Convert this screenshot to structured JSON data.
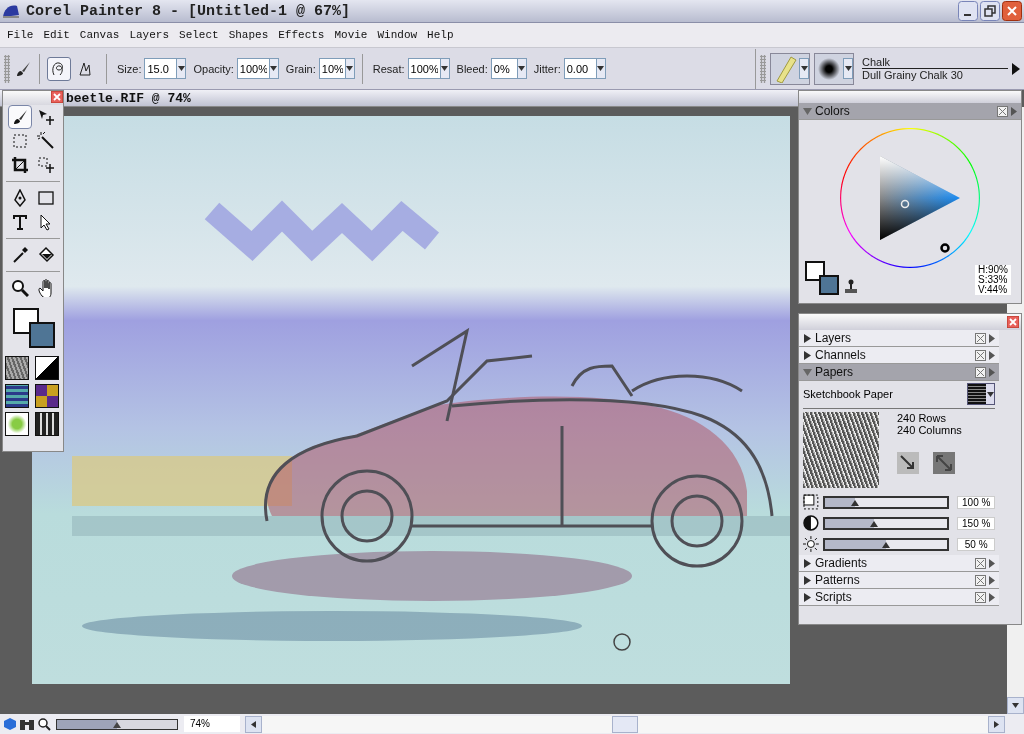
{
  "window": {
    "title": "Corel Painter 8 - [Untitled-1 @ 67%]"
  },
  "menu": [
    "File",
    "Edit",
    "Canvas",
    "Layers",
    "Select",
    "Shapes",
    "Effects",
    "Movie",
    "Window",
    "Help"
  ],
  "property_bar": {
    "stroke_modes": [
      {
        "selected": true
      },
      {
        "selected": false
      }
    ],
    "fields": [
      {
        "label": "Size:",
        "value": "15.0"
      },
      {
        "label": "Opacity:",
        "value": "100%"
      },
      {
        "label": "Grain:",
        "value": "10%"
      },
      {
        "label": "Resat:",
        "value": "100%"
      },
      {
        "label": "Bleed:",
        "value": "0%"
      },
      {
        "label": "Jitter:",
        "value": "0.00"
      }
    ],
    "brush": {
      "category": "Chalk",
      "variant": "Dull Grainy Chalk 30"
    }
  },
  "document": {
    "title": "beetle.RIF @ 74%"
  },
  "toolbox": {
    "tools": [
      {
        "kind": "brush",
        "selected": true
      },
      {
        "kind": "layer-adjuster",
        "selected": false
      },
      {
        "kind": "rect-selection",
        "selected": false
      },
      {
        "kind": "magic-wand",
        "selected": false
      },
      {
        "kind": "crop",
        "selected": false
      },
      {
        "kind": "selection-adjuster",
        "selected": false
      },
      {
        "kind": "pen",
        "selected": false
      },
      {
        "kind": "rectangle",
        "selected": false
      },
      {
        "kind": "text",
        "selected": false
      },
      {
        "kind": "shape-selection",
        "selected": false
      },
      {
        "kind": "dropper",
        "selected": false
      },
      {
        "kind": "paint-bucket",
        "selected": false
      },
      {
        "kind": "magnifier",
        "selected": false
      },
      {
        "kind": "grabber",
        "selected": false
      }
    ],
    "colors": [
      {
        "color": "#ffffff"
      },
      {
        "color": "#4f7595"
      }
    ]
  },
  "colors_panel": {
    "title": "Colors",
    "expanded": true,
    "readout": [
      "H:90%",
      "S:33%",
      "V:44%"
    ]
  },
  "palette": {
    "sections": [
      {
        "title": "Layers",
        "expanded": false
      },
      {
        "title": "Channels",
        "expanded": false
      },
      {
        "title": "Papers",
        "expanded": true
      },
      {
        "title": "Gradients",
        "expanded": false
      },
      {
        "title": "Patterns",
        "expanded": false
      },
      {
        "title": "Scripts",
        "expanded": false
      }
    ]
  },
  "papers": {
    "name": "Sketchbook Paper",
    "rows": "240 Rows",
    "columns": "240 Columns",
    "sliders": [
      {
        "kind": "scale",
        "level": 0.25,
        "reading": "100 %"
      },
      {
        "kind": "contrast",
        "level": 0.4,
        "reading": "150 %"
      },
      {
        "kind": "brightness",
        "level": 0.5,
        "reading": "50 %"
      }
    ]
  },
  "status_bar": {
    "zoom": {
      "level": 0.5,
      "reading": "74%"
    }
  }
}
